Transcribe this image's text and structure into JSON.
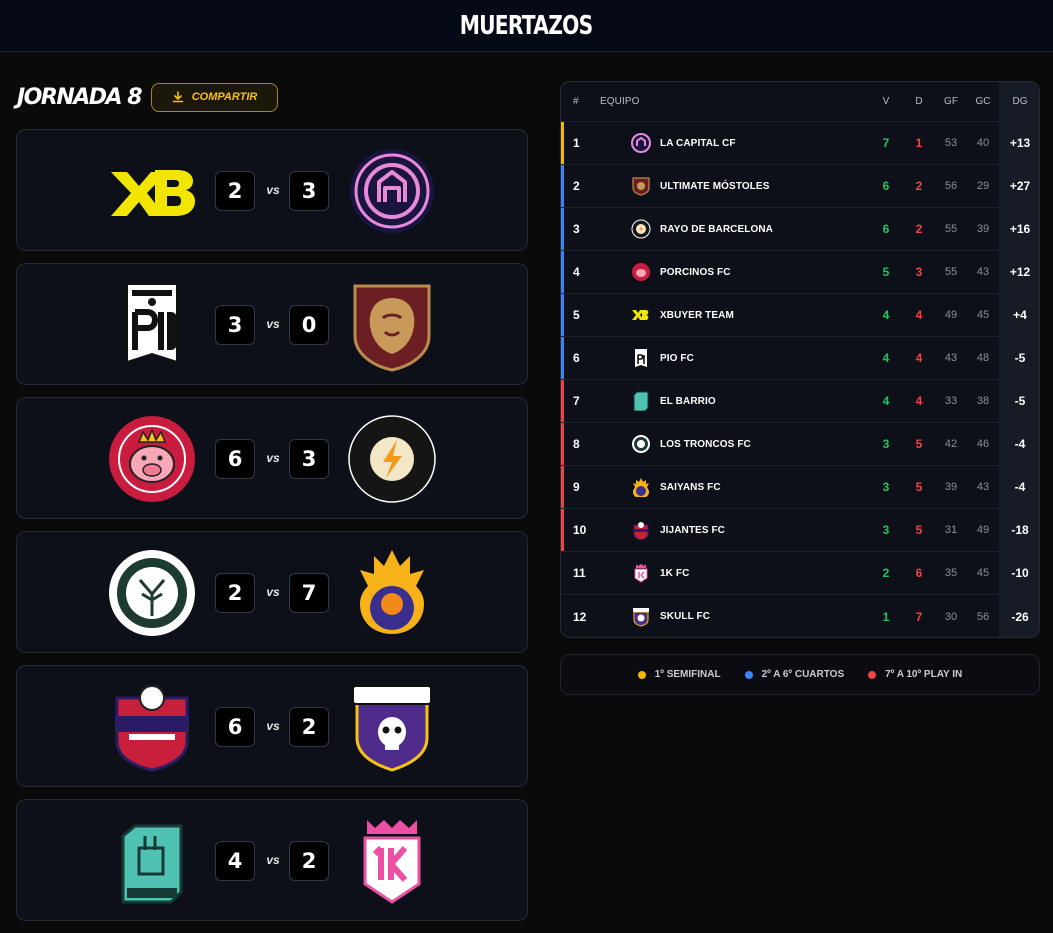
{
  "app": {
    "brand": "MUERTAZOS"
  },
  "header": {
    "title": "JORNADA 8",
    "share_label": "COMPARTIR"
  },
  "colors": {
    "gold": "#f6c312",
    "win": "#22c55e",
    "loss": "#ef4444",
    "semi": "#f5b800",
    "cuartos": "#3b82f6",
    "playin": "#ef4444"
  },
  "matches": [
    {
      "home": "XBUYER TEAM",
      "home_score": "2",
      "vs": "vs",
      "away": "LA CAPITAL CF",
      "away_score": "3"
    },
    {
      "home": "PIO FC",
      "home_score": "3",
      "vs": "vs",
      "away": "ULTIMATE MÓSTOLES",
      "away_score": "0"
    },
    {
      "home": "PORCINOS FC",
      "home_score": "6",
      "vs": "vs",
      "away": "RAYO DE BARCELONA",
      "away_score": "3"
    },
    {
      "home": "LOS TRONCOS FC",
      "home_score": "2",
      "vs": "vs",
      "away": "SAIYANS FC",
      "away_score": "7"
    },
    {
      "home": "JIJANTES FC",
      "home_score": "6",
      "vs": "vs",
      "away": "SKULL FC",
      "away_score": "2"
    },
    {
      "home": "EL BARRIO",
      "home_score": "4",
      "vs": "vs",
      "away": "1K FC",
      "away_score": "2"
    }
  ],
  "standings": {
    "columns": {
      "pos": "#",
      "team": "EQUIPO",
      "v": "V",
      "d": "D",
      "gf": "GF",
      "gc": "GC",
      "dg": "DG"
    },
    "rows": [
      {
        "pos": "1",
        "team": "LA CAPITAL CF",
        "v": "7",
        "d": "1",
        "gf": "53",
        "gc": "40",
        "dg": "+13",
        "zone": "semi"
      },
      {
        "pos": "2",
        "team": "ULTIMATE MÓSTOLES",
        "v": "6",
        "d": "2",
        "gf": "56",
        "gc": "29",
        "dg": "+27",
        "zone": "cuartos"
      },
      {
        "pos": "3",
        "team": "RAYO DE BARCELONA",
        "v": "6",
        "d": "2",
        "gf": "55",
        "gc": "39",
        "dg": "+16",
        "zone": "cuartos"
      },
      {
        "pos": "4",
        "team": "PORCINOS FC",
        "v": "5",
        "d": "3",
        "gf": "55",
        "gc": "43",
        "dg": "+12",
        "zone": "cuartos"
      },
      {
        "pos": "5",
        "team": "XBUYER TEAM",
        "v": "4",
        "d": "4",
        "gf": "49",
        "gc": "45",
        "dg": "+4",
        "zone": "cuartos"
      },
      {
        "pos": "6",
        "team": "PIO FC",
        "v": "4",
        "d": "4",
        "gf": "43",
        "gc": "48",
        "dg": "-5",
        "zone": "cuartos"
      },
      {
        "pos": "7",
        "team": "EL BARRIO",
        "v": "4",
        "d": "4",
        "gf": "33",
        "gc": "38",
        "dg": "-5",
        "zone": "playin"
      },
      {
        "pos": "8",
        "team": "LOS TRONCOS FC",
        "v": "3",
        "d": "5",
        "gf": "42",
        "gc": "46",
        "dg": "-4",
        "zone": "playin"
      },
      {
        "pos": "9",
        "team": "SAIYANS FC",
        "v": "3",
        "d": "5",
        "gf": "39",
        "gc": "43",
        "dg": "-4",
        "zone": "playin"
      },
      {
        "pos": "10",
        "team": "JIJANTES FC",
        "v": "3",
        "d": "5",
        "gf": "31",
        "gc": "49",
        "dg": "-18",
        "zone": "playin"
      },
      {
        "pos": "11",
        "team": "1K FC",
        "v": "2",
        "d": "6",
        "gf": "35",
        "gc": "45",
        "dg": "-10",
        "zone": "none"
      },
      {
        "pos": "12",
        "team": "SKULL FC",
        "v": "1",
        "d": "7",
        "gf": "30",
        "gc": "56",
        "dg": "-26",
        "zone": "none"
      }
    ]
  },
  "legend": [
    {
      "label": "1º SEMIFINAL",
      "color": "#f5b800"
    },
    {
      "label": "2º A 6º CUARTOS",
      "color": "#3b82f6"
    },
    {
      "label": "7º A 10º PLAY IN",
      "color": "#ef4444"
    }
  ]
}
